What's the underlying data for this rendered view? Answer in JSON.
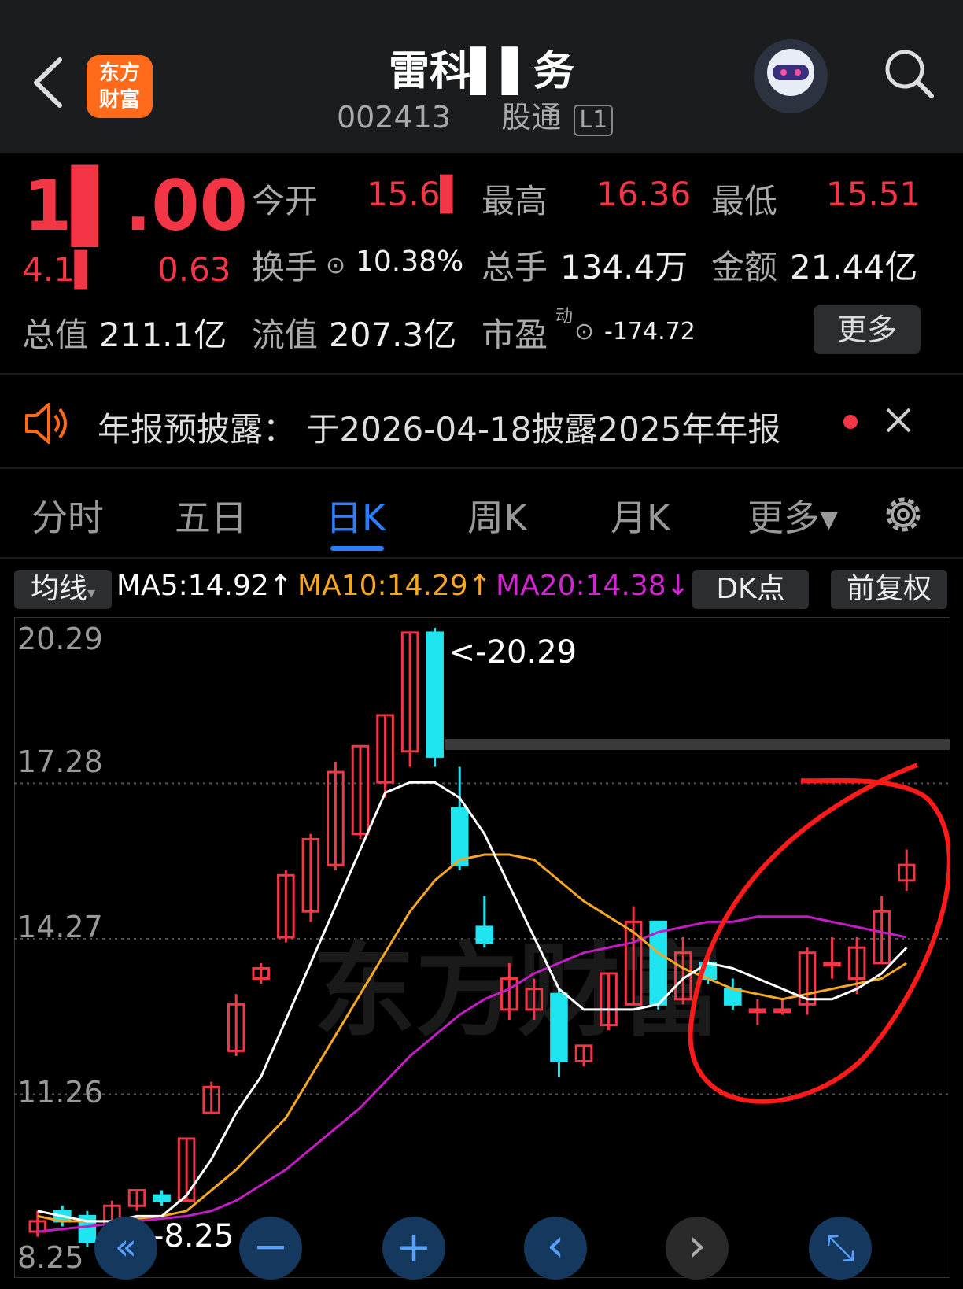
{
  "header": {
    "title": "雷科▌▌务",
    "code": "002413",
    "tag": "股通",
    "level": "L1"
  },
  "quote": {
    "price": "1▌.00",
    "change_pct": "4.1▌",
    "change": "0.63",
    "open_label": "今开",
    "open": "15.6▌",
    "high_label": "最高",
    "high": "16.36",
    "low_label": "最低",
    "low": "15.51",
    "turnover_label": "换手",
    "turnover": "10.38%",
    "volume_label": "总手",
    "volume": "134.4万",
    "amount_label": "金额",
    "amount": "21.44亿",
    "mktcap_label": "总值",
    "mktcap": "211.1亿",
    "float_label": "流值",
    "float_cap": "207.3亿",
    "pe_label": "市盈",
    "pe_sup": "动",
    "pe": "-174.72",
    "more": "更多"
  },
  "notice": {
    "text": "年报预披露：  于2026-04-18披露2025年年报"
  },
  "tabs": [
    "分时",
    "五日",
    "日K",
    "周K",
    "月K",
    "更多▾"
  ],
  "active_tab": "日K",
  "indicator": {
    "selector": "均线",
    "ma5": "MA5:14.92↑",
    "ma10": "MA10:14.29↑",
    "ma20": "MA20:14.38↓",
    "dk": "DK点",
    "adjust": "前复权"
  },
  "colors": {
    "up": "#f23645",
    "down": "#1fe5f0",
    "ma5": "#ffffff",
    "ma10": "#f5a623",
    "ma20": "#c41cc4",
    "accent": "#2b7fff"
  },
  "chart": {
    "y_ticks": [
      "20.29",
      "17.28",
      "14.27",
      "11.26",
      "8.25"
    ],
    "max_label": "<-20.29",
    "min_label": "<-8.25",
    "watermark": "东方财富"
  },
  "chart_data": {
    "type": "candlestick",
    "ylim": [
      8.25,
      20.29
    ],
    "candles": [
      {
        "o": 8.6,
        "c": 8.8,
        "h": 9.0,
        "l": 8.5
      },
      {
        "o": 9.0,
        "c": 8.8,
        "h": 9.1,
        "l": 8.7
      },
      {
        "o": 8.9,
        "c": 8.4,
        "h": 9.0,
        "l": 8.3
      },
      {
        "o": 8.3,
        "c": 9.1,
        "h": 9.2,
        "l": 8.25
      },
      {
        "o": 9.1,
        "c": 9.4,
        "h": 9.4,
        "l": 9.0
      },
      {
        "o": 9.3,
        "c": 9.2,
        "h": 9.4,
        "l": 9.1
      },
      {
        "o": 9.2,
        "c": 10.4,
        "h": 10.4,
        "l": 9.2
      },
      {
        "o": 10.9,
        "c": 11.4,
        "h": 11.5,
        "l": 10.9
      },
      {
        "o": 12.1,
        "c": 13.0,
        "h": 13.2,
        "l": 12.0
      },
      {
        "o": 13.5,
        "c": 13.7,
        "h": 13.8,
        "l": 13.4
      },
      {
        "o": 14.3,
        "c": 15.5,
        "h": 15.6,
        "l": 14.2
      },
      {
        "o": 14.8,
        "c": 16.2,
        "h": 16.3,
        "l": 14.6
      },
      {
        "o": 15.7,
        "c": 17.5,
        "h": 17.7,
        "l": 15.6
      },
      {
        "o": 16.3,
        "c": 18.0,
        "h": 18.0,
        "l": 16.2
      },
      {
        "o": 17.3,
        "c": 18.6,
        "h": 18.6,
        "l": 17.0
      },
      {
        "o": 17.9,
        "c": 20.2,
        "h": 20.2,
        "l": 17.6
      },
      {
        "o": 20.2,
        "c": 17.8,
        "h": 20.29,
        "l": 17.6
      },
      {
        "o": 16.8,
        "c": 15.7,
        "h": 17.6,
        "l": 15.6
      },
      {
        "o": 14.5,
        "c": 14.2,
        "h": 15.1,
        "l": 14.1
      },
      {
        "o": 12.9,
        "c": 13.5,
        "h": 13.8,
        "l": 12.7
      },
      {
        "o": 12.9,
        "c": 13.3,
        "h": 13.5,
        "l": 12.7
      },
      {
        "o": 13.2,
        "c": 11.9,
        "h": 13.3,
        "l": 11.6
      },
      {
        "o": 11.9,
        "c": 12.2,
        "h": 12.2,
        "l": 11.8
      },
      {
        "o": 12.6,
        "c": 13.6,
        "h": 13.6,
        "l": 12.5
      },
      {
        "o": 13.0,
        "c": 14.6,
        "h": 14.9,
        "l": 13.0
      },
      {
        "o": 14.6,
        "c": 13.0,
        "h": 14.6,
        "l": 12.9
      },
      {
        "o": 13.1,
        "c": 14.0,
        "h": 14.3,
        "l": 13.0
      },
      {
        "o": 13.8,
        "c": 13.5,
        "h": 13.9,
        "l": 13.4
      },
      {
        "o": 13.3,
        "c": 13.0,
        "h": 13.5,
        "l": 12.9
      },
      {
        "o": 12.9,
        "c": 12.9,
        "h": 13.1,
        "l": 12.6
      },
      {
        "o": 12.9,
        "c": 12.9,
        "h": 13.1,
        "l": 12.8
      },
      {
        "o": 13.0,
        "c": 14.0,
        "h": 14.1,
        "l": 12.8
      },
      {
        "o": 13.8,
        "c": 13.8,
        "h": 14.3,
        "l": 13.5
      },
      {
        "o": 13.5,
        "c": 14.1,
        "h": 14.3,
        "l": 13.2
      },
      {
        "o": 13.8,
        "c": 14.8,
        "h": 15.1,
        "l": 13.8
      },
      {
        "o": 15.4,
        "c": 15.7,
        "h": 16.0,
        "l": 15.2
      }
    ],
    "ma5": [
      9.0,
      8.9,
      8.8,
      8.8,
      8.9,
      8.9,
      9.3,
      10.0,
      10.9,
      11.6,
      12.7,
      13.8,
      14.9,
      16.0,
      17.1,
      17.3,
      17.3,
      17.0,
      16.3,
      15.3,
      14.3,
      13.3,
      12.9,
      12.9,
      12.9,
      13.0,
      13.5,
      13.8,
      13.7,
      13.5,
      13.3,
      13.1,
      13.1,
      13.3,
      13.6,
      14.1
    ],
    "ma10": [
      8.9,
      8.8,
      8.8,
      8.8,
      8.85,
      8.9,
      9.0,
      9.4,
      9.8,
      10.3,
      10.8,
      11.6,
      12.4,
      13.2,
      14.0,
      14.8,
      15.4,
      15.8,
      15.9,
      15.9,
      15.8,
      15.4,
      15.0,
      14.7,
      14.4,
      14.0,
      13.7,
      13.5,
      13.3,
      13.2,
      13.1,
      13.2,
      13.3,
      13.4,
      13.5,
      13.8
    ],
    "ma20": [
      8.6,
      8.65,
      8.7,
      8.75,
      8.8,
      8.85,
      8.9,
      9.0,
      9.2,
      9.5,
      9.8,
      10.2,
      10.6,
      11.0,
      11.5,
      12.0,
      12.4,
      12.8,
      13.1,
      13.3,
      13.6,
      13.8,
      14.0,
      14.1,
      14.2,
      14.4,
      14.5,
      14.6,
      14.6,
      14.7,
      14.7,
      14.7,
      14.6,
      14.5,
      14.4,
      14.3
    ]
  },
  "bottom_buttons": [
    "«",
    "−",
    "+",
    "‹",
    "›",
    "⤡"
  ]
}
